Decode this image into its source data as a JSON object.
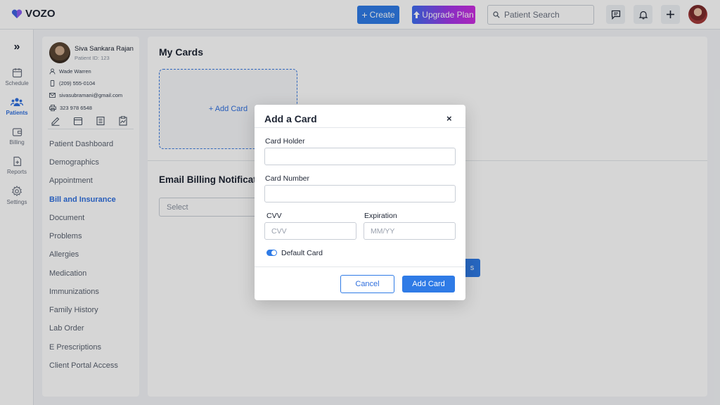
{
  "app": {
    "logo_text": "VOZO"
  },
  "header": {
    "create_label": "Create",
    "upgrade_label": "Upgrade Plan",
    "search_placeholder": "Patient Search"
  },
  "rail": {
    "items": [
      {
        "label": "Schedule",
        "icon": "calendar-icon"
      },
      {
        "label": "Patients",
        "icon": "users-icon",
        "active": true
      },
      {
        "label": "Billing",
        "icon": "wallet-icon"
      },
      {
        "label": "Reports",
        "icon": "report-icon"
      },
      {
        "label": "Settings",
        "icon": "gear-icon"
      }
    ]
  },
  "patient": {
    "name": "Siva Sankara Rajan",
    "id_label": "Patient ID: 123",
    "contact_person": "Wade Warren",
    "phone": "(209) 555-0104",
    "email": "sivasubramani@gmail.com",
    "fax": "323 978 6548"
  },
  "menu": {
    "items": [
      "Patient Dashboard",
      "Demographics",
      "Appointment",
      "Bill and Insurance",
      "Document",
      "Problems",
      "Allergies",
      "Medication",
      "Immunizations",
      "Family History",
      "Lab Order",
      "E Prescriptions",
      "Client Portal Access"
    ],
    "active": "Bill and Insurance"
  },
  "main": {
    "title": "My Cards",
    "add_card_tile": "+ Add Card",
    "email_title": "Email Billing Notifications",
    "select_placeholder": "Select",
    "save_fragment": "s"
  },
  "modal": {
    "title": "Add a Card",
    "close_symbol": "×",
    "card_holder_label": "Card Holder",
    "card_holder_value": "",
    "card_number_label": "Card Number",
    "card_number_value": "",
    "cvv_label": "CVV",
    "cvv_placeholder": "CVV",
    "expiration_label": "Expiration",
    "expiration_placeholder": "MM/YY",
    "default_card_label": "Default Card",
    "default_card_on": true,
    "cancel_label": "Cancel",
    "add_label": "Add Card"
  },
  "colors": {
    "primary": "#2f7be6",
    "accent_active": "#2f6fde"
  }
}
